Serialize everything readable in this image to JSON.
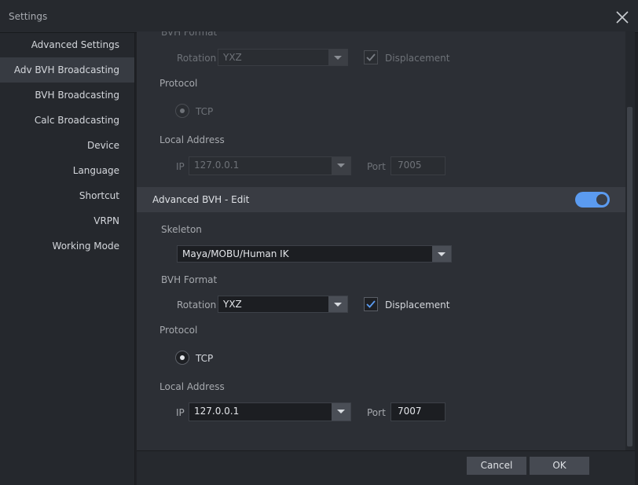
{
  "window": {
    "title": "Settings"
  },
  "sidebar": {
    "items": [
      {
        "label": "Advanced Settings"
      },
      {
        "label": "Adv BVH Broadcasting",
        "active": true
      },
      {
        "label": "BVH Broadcasting"
      },
      {
        "label": "Calc Broadcasting"
      },
      {
        "label": "Device"
      },
      {
        "label": "Language"
      },
      {
        "label": "Shortcut"
      },
      {
        "label": "VRPN"
      },
      {
        "label": "Working Mode"
      }
    ]
  },
  "top_section": {
    "bvh_format_label": "BVH Format",
    "rotation_label": "Rotation",
    "rotation_value": "YXZ",
    "displacement_label": "Displacement",
    "displacement_checked": true,
    "protocol_label": "Protocol",
    "tcp_label": "TCP",
    "local_address_label": "Local Address",
    "ip_label": "IP",
    "ip_value": "127.0.0.1",
    "port_label": "Port",
    "port_value": "7005"
  },
  "advanced_edit": {
    "header_label": "Advanced BVH - Edit",
    "enabled": true,
    "skeleton_label": "Skeleton",
    "skeleton_value": "Maya/MOBU/Human IK",
    "bvh_format_label": "BVH Format",
    "rotation_label": "Rotation",
    "rotation_value": "YXZ",
    "displacement_label": "Displacement",
    "displacement_checked": true,
    "protocol_label": "Protocol",
    "tcp_label": "TCP",
    "local_address_label": "Local Address",
    "ip_label": "IP",
    "ip_value": "127.0.0.1",
    "port_label": "Port",
    "port_value": "7007"
  },
  "footer": {
    "cancel_label": "Cancel",
    "ok_label": "OK"
  },
  "colors": {
    "accent": "#5b9bf0",
    "background": "#2c2f35",
    "sidebar_active": "#373b42"
  }
}
